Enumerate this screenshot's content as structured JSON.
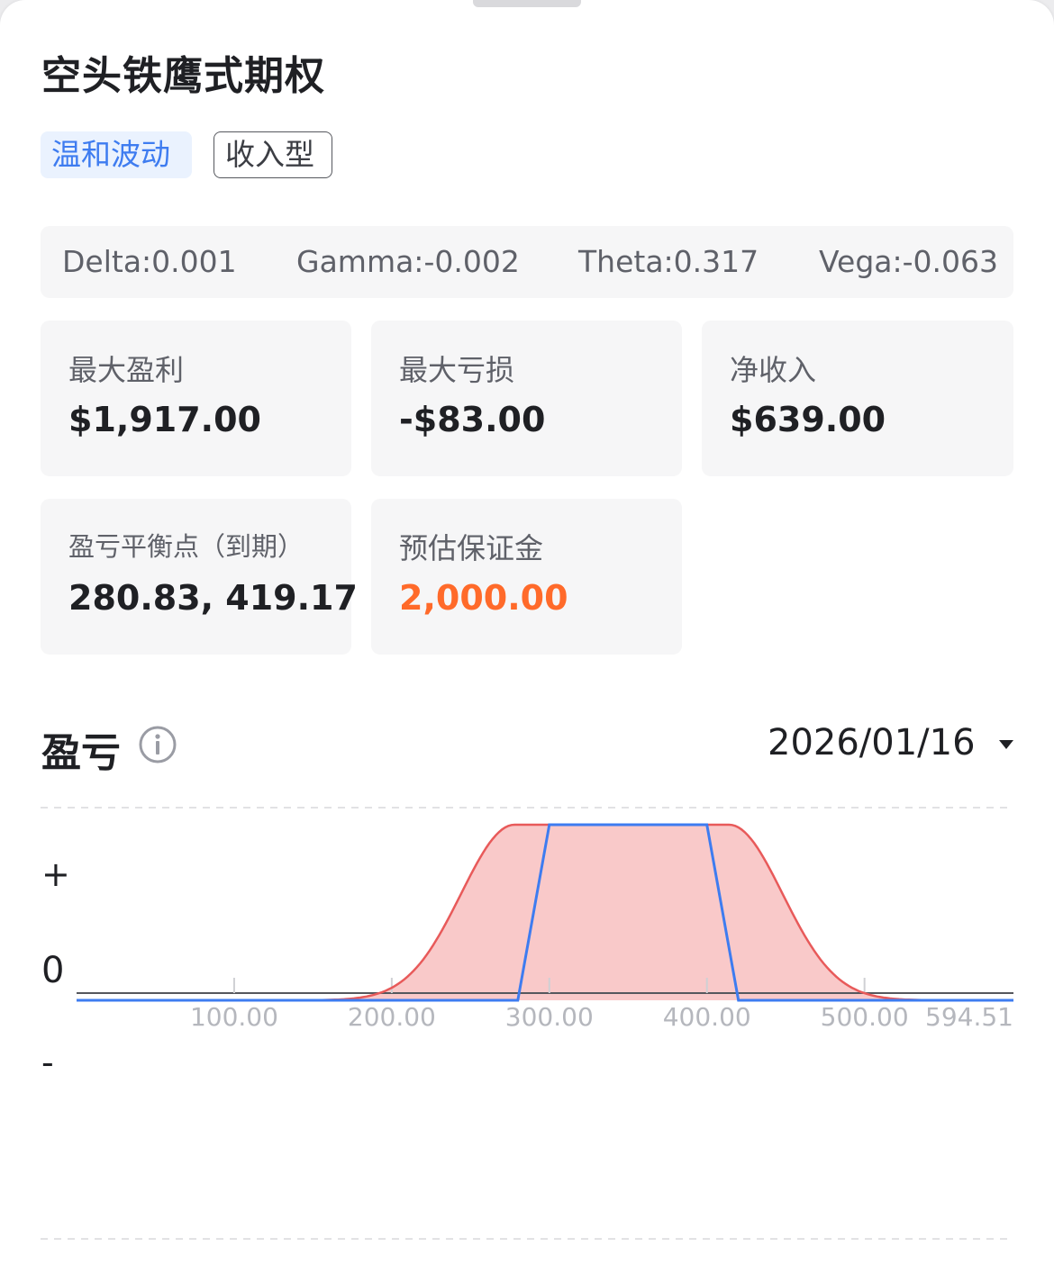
{
  "header": {
    "title": "空头铁鹰式期权",
    "tags": [
      "温和波动",
      "收入型"
    ]
  },
  "greeks": [
    {
      "label": "Delta:",
      "value": "0.001"
    },
    {
      "label": "Gamma:",
      "value": "-0.002"
    },
    {
      "label": "Theta:",
      "value": "0.317"
    },
    {
      "label": "Vega:",
      "value": "-0.063"
    }
  ],
  "stats": {
    "max_profit": {
      "label": "最大盈利",
      "value": "$1,917.00"
    },
    "max_loss": {
      "label": "最大亏损",
      "value": "-$83.00"
    },
    "net_income": {
      "label": "净收入",
      "value": "$639.00"
    },
    "breakeven": {
      "label": "盈亏平衡点（到期）",
      "value": "280.83, 419.17"
    },
    "margin": {
      "label": "预估保证金",
      "value": "2,000.00"
    }
  },
  "pl_section": {
    "title": "盈亏",
    "date": "2026/01/16",
    "info_icon": "info-icon",
    "dropdown_icon": "caret-down-icon"
  },
  "colors": {
    "accent_blue": "#3e7cf0",
    "margin_orange": "#ff6a2a",
    "theoretical_red": "#e85a5a",
    "theoretical_fill": "#f9c9c9"
  },
  "chart_data": {
    "type": "line",
    "y_axis_labels": [
      "+",
      "0",
      "-"
    ],
    "x_tick_labels": [
      "100.00",
      "200.00",
      "300.00",
      "400.00",
      "500.00",
      "594.51"
    ],
    "xlim": [
      0,
      594.51
    ],
    "breakevens": [
      280.83,
      419.17
    ],
    "series": [
      {
        "line": "expiration",
        "color": "#3e7cf0",
        "x": [
          0,
          280,
          300,
          400,
          420,
          594.51
        ],
        "y": [
          -83,
          -83,
          1917,
          1917,
          -83,
          -83
        ]
      },
      {
        "line": "current",
        "color": "#e85a5a",
        "fill": "#f9c9c9",
        "center": 346,
        "plateau": 1917,
        "floor": -83
      }
    ]
  }
}
